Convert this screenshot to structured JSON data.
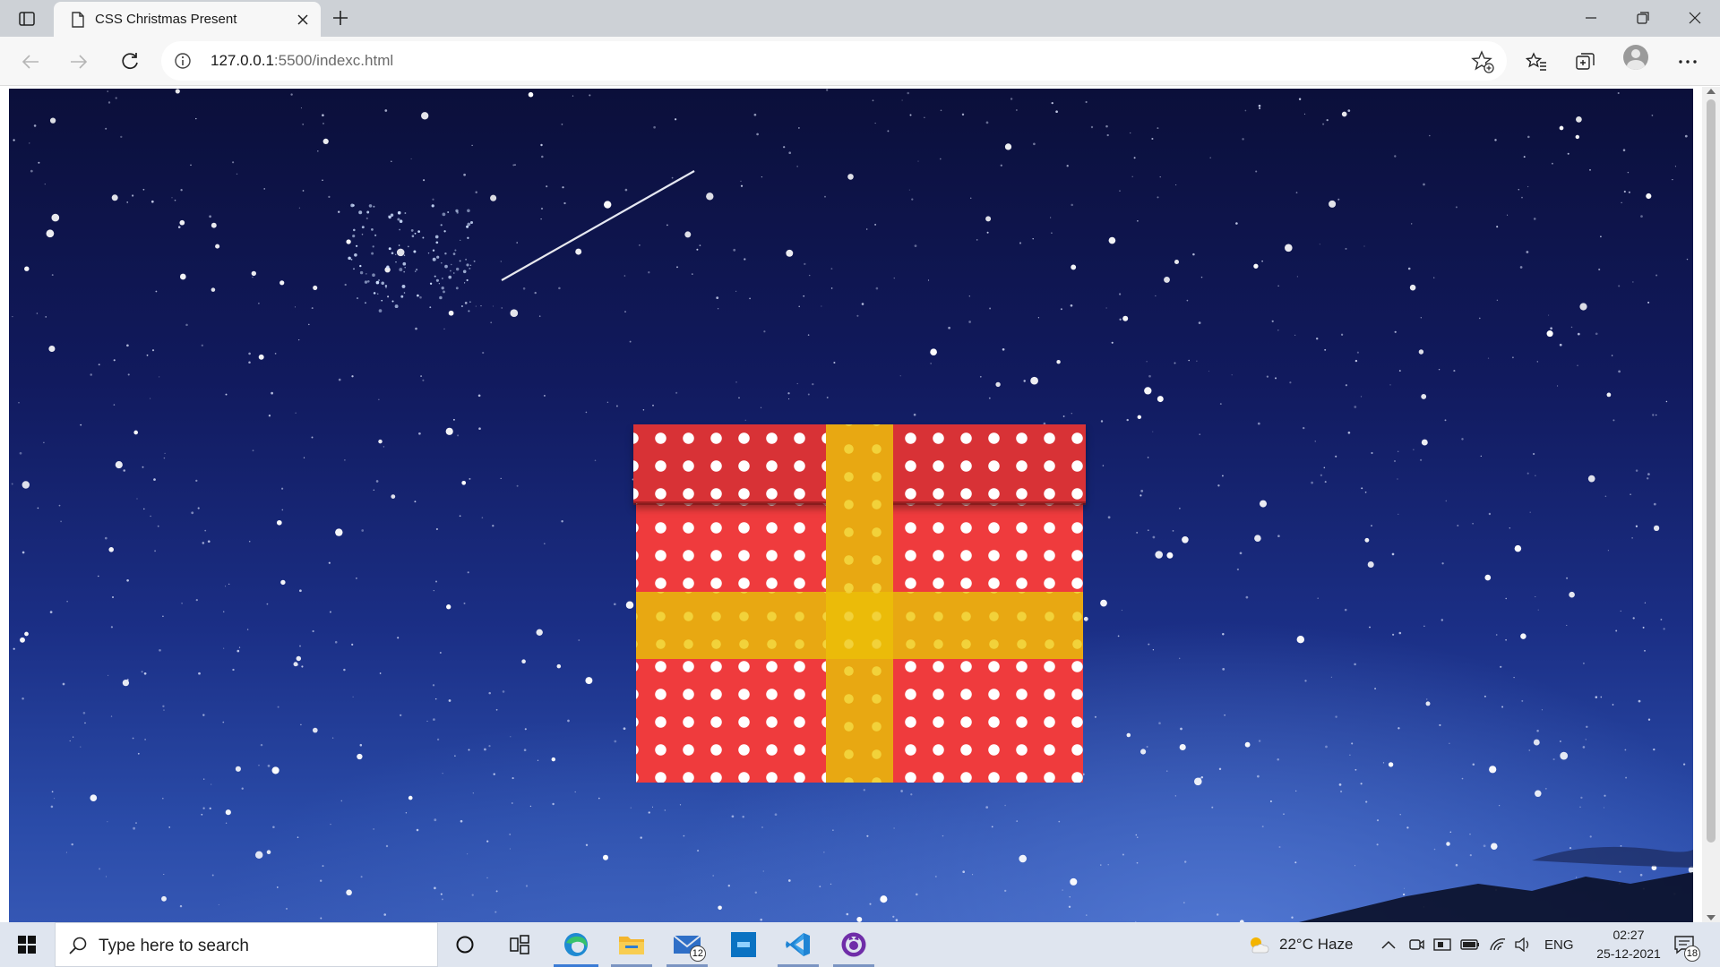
{
  "browser": {
    "tab_title": "CSS Christmas Present",
    "url_host": "127.0.0.1",
    "url_rest": ":5500/indexc.html",
    "icons": {
      "tab_actions": "tab-actions-icon",
      "page": "page-icon",
      "close": "close-icon",
      "new_tab": "plus-icon",
      "minimize": "minimize-icon",
      "restore": "restore-icon",
      "window_close": "close-icon",
      "back": "back-arrow-icon",
      "forward": "forward-arrow-icon",
      "refresh": "refresh-icon",
      "info": "info-icon",
      "add_favorite": "star-plus-icon",
      "favorites": "favorites-icon",
      "collections": "collections-icon",
      "profile": "avatar",
      "more": "more-icon"
    }
  },
  "page": {
    "scene": "gift box on starry night sky",
    "colors": {
      "gift_red": "#ef3b3d",
      "lid_red": "#d83236",
      "ribbon_gold": "#e8a812",
      "dots": "#ffffff"
    }
  },
  "taskbar": {
    "search_placeholder": "Type here to search",
    "apps": [
      "cortana-icon",
      "task-view-icon",
      "edge-icon",
      "file-explorer-icon",
      "mail-icon",
      "dell-app-icon",
      "vscode-icon",
      "github-desktop-icon"
    ],
    "mail_badge": "12",
    "weather": "22°C  Haze",
    "language": "ENG",
    "time": "02:27",
    "date": "25-12-2021",
    "notifications_badge": "18"
  }
}
